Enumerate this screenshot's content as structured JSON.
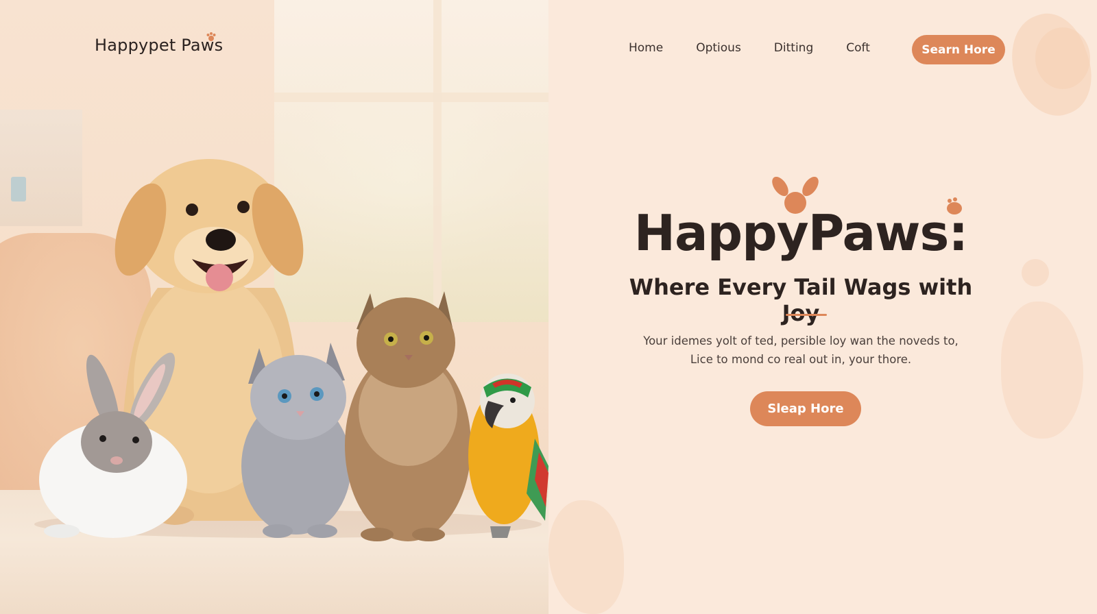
{
  "brand": {
    "name": "Happypet Paws"
  },
  "nav": {
    "items": [
      {
        "label": "Home"
      },
      {
        "label": "Optious"
      },
      {
        "label": "Ditting"
      },
      {
        "label": "Coft"
      }
    ],
    "cta_label": "Searn Hore"
  },
  "hero": {
    "title": "HappyPaws:",
    "subtitle": "Where Every Tail Wags with Joy",
    "body_line1": "Your idemes yolt of ted, persible loy wan the noveds to,",
    "body_line2": "Lice to mond co real out in, your thore.",
    "cta_label": "Sleap Hore"
  },
  "colors": {
    "accent": "#dd8759",
    "background": "#fbe9db",
    "text_dark": "#2d2320"
  },
  "icons": {
    "logo_mark": "paw-icon",
    "title_decoration": "bunny-ears-icon",
    "title_sparkle": "small-paw-icon"
  }
}
